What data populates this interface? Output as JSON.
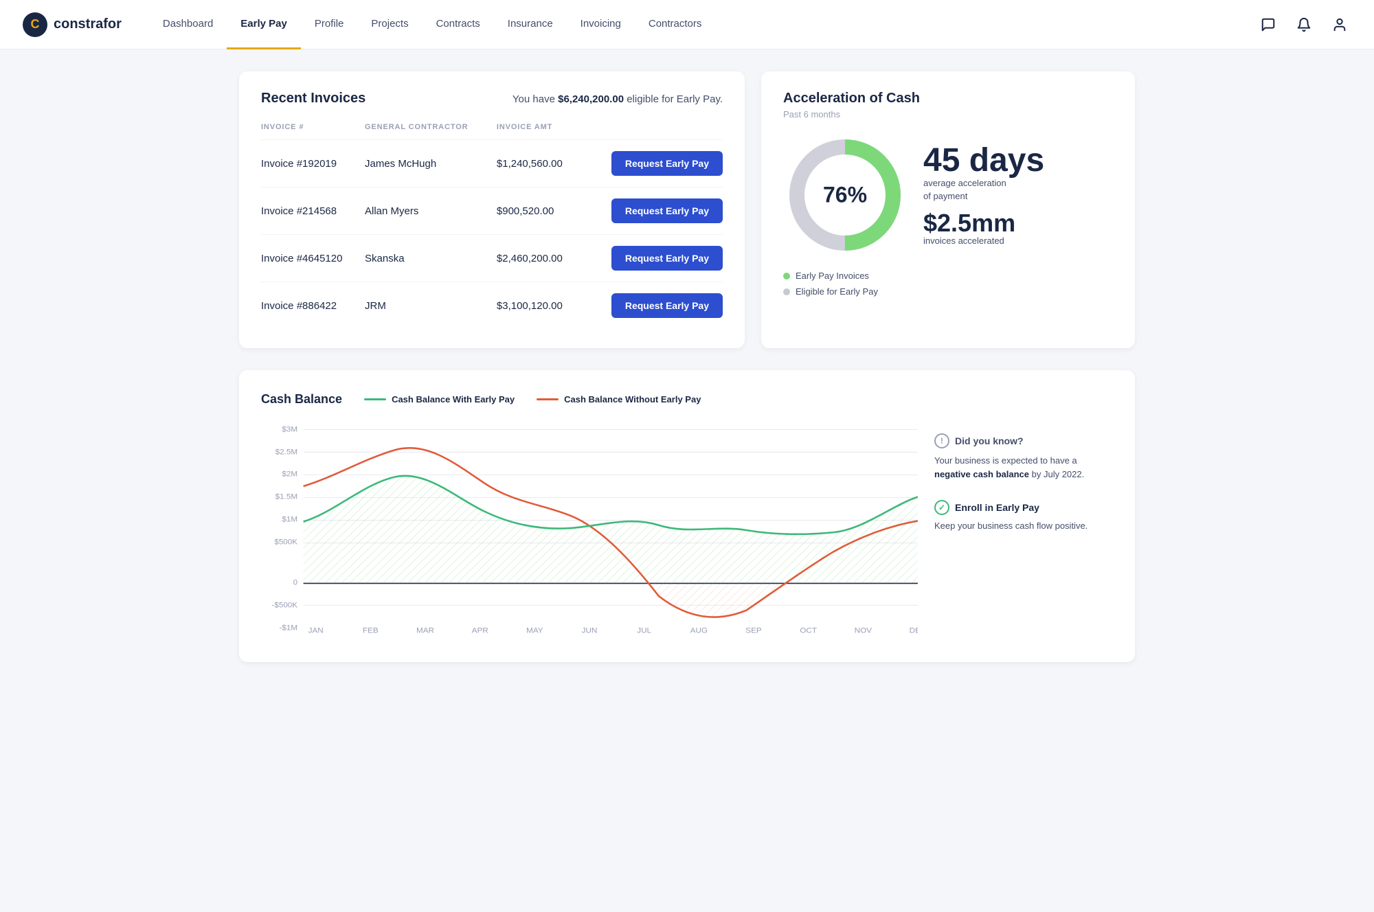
{
  "nav": {
    "logo_text": "constrafor",
    "links": [
      {
        "id": "dashboard",
        "label": "Dashboard",
        "active": false
      },
      {
        "id": "early-pay",
        "label": "Early Pay",
        "active": true
      },
      {
        "id": "profile",
        "label": "Profile",
        "active": false
      },
      {
        "id": "projects",
        "label": "Projects",
        "active": false
      },
      {
        "id": "contracts",
        "label": "Contracts",
        "active": false
      },
      {
        "id": "insurance",
        "label": "Insurance",
        "active": false
      },
      {
        "id": "invoicing",
        "label": "Invoicing",
        "active": false
      },
      {
        "id": "contractors",
        "label": "Contractors",
        "active": false
      }
    ]
  },
  "invoices": {
    "title": "Recent Invoices",
    "eligible_prefix": "You have ",
    "eligible_amount": "$6,240,200.00",
    "eligible_suffix": " eligible for Early Pay.",
    "columns": [
      "Invoice #",
      "General Contractor",
      "Invoice Amt"
    ],
    "rows": [
      {
        "id": "Invoice #192019",
        "contractor": "James McHugh",
        "amount": "$1,240,560.00"
      },
      {
        "id": "Invoice #214568",
        "contractor": "Allan Myers",
        "amount": "$900,520.00"
      },
      {
        "id": "Invoice #4645120",
        "contractor": "Skanska",
        "amount": "$2,460,200.00"
      },
      {
        "id": "Invoice #886422",
        "contractor": "JRM",
        "amount": "$3,100,120.00"
      }
    ],
    "button_label": "Request Early Pay"
  },
  "acceleration": {
    "title": "Acceleration of Cash",
    "subtitle": "Past 6 months",
    "donut_percent": "76%",
    "donut_green_pct": 76,
    "days": "45 days",
    "days_label": "average acceleration\nof payment",
    "amount": "$2.5mm",
    "amount_label": "invoices accelerated",
    "legend": [
      {
        "label": "Early Pay Invoices",
        "color": "#7dd87a"
      },
      {
        "label": "Eligible for Early Pay",
        "color": "#c8c8d0"
      }
    ]
  },
  "cash_balance": {
    "title": "Cash Balance",
    "legend": [
      {
        "label": "Cash Balance With Early Pay",
        "color": "#3db87a"
      },
      {
        "label": "Cash Balance Without Early Pay",
        "color": "#e05c3a"
      }
    ],
    "y_labels": [
      "$3M",
      "$2.5M",
      "$2M",
      "$1.5M",
      "$1M",
      "$500K",
      "0",
      "-$500K",
      "-$1M"
    ],
    "x_labels": [
      "JAN",
      "FEB",
      "MAR",
      "APR",
      "MAY",
      "JUN",
      "JUL",
      "AUG",
      "SEP",
      "OCT",
      "NOV",
      "DEC"
    ]
  },
  "sidebar": {
    "tip_title": "Did you know?",
    "tip_text": "Your business is expected to have a ",
    "tip_bold": "negative cash balance",
    "tip_text2": " by July 2022.",
    "enroll_title": "Enroll in Early Pay",
    "enroll_desc": "Keep your business cash flow positive."
  }
}
